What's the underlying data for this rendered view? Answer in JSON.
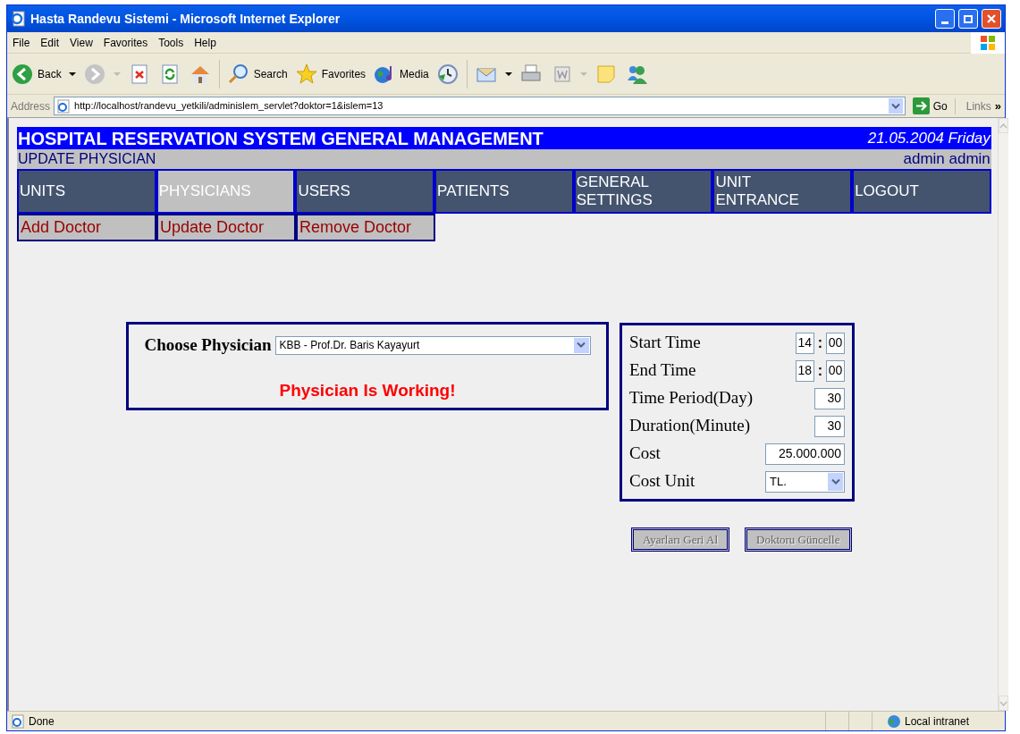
{
  "window": {
    "title": "Hasta Randevu Sistemi - Microsoft Internet Explorer"
  },
  "menu": [
    "File",
    "Edit",
    "View",
    "Favorites",
    "Tools",
    "Help"
  ],
  "toolbar": {
    "back": "Back",
    "search": "Search",
    "favorites": "Favorites",
    "media": "Media"
  },
  "address": {
    "label": "Address",
    "url": "http://localhost/randevu_yetkili/adminislem_servlet?doktor=1&islem=13",
    "go": "Go",
    "links": "Links",
    "more": "»"
  },
  "header": {
    "title": "HOSPITAL RESERVATION SYSTEM GENERAL MANAGEMENT",
    "date": "21.05.2004 Friday",
    "subtitle": "UPDATE PHYSICIAN",
    "user": "admin admin"
  },
  "nav": [
    {
      "label": "UNITS",
      "selected": false
    },
    {
      "label": "PHYSICIANS",
      "selected": true
    },
    {
      "label": "USERS",
      "selected": false
    },
    {
      "label": "PATIENTS",
      "selected": false
    },
    {
      "label": "GENERAL SETTINGS",
      "selected": false
    },
    {
      "label": "UNIT ENTRANCE",
      "selected": false
    },
    {
      "label": "LOGOUT",
      "selected": false
    }
  ],
  "subnav": [
    "Add Doctor",
    "Update Doctor",
    "Remove Doctor"
  ],
  "physician": {
    "label": "Choose Physician",
    "value": "KBB - Prof.Dr. Baris Kayayurt",
    "message": "Physician Is Working!"
  },
  "settings": [
    {
      "label": "Start Time",
      "kind": "time",
      "hour": "14",
      "sep": ":",
      "minute": "00"
    },
    {
      "label": "End Time",
      "kind": "time",
      "hour": "18",
      "sep": ":",
      "minute": "00"
    },
    {
      "label": "Time Period(Day)",
      "kind": "number",
      "value": "30"
    },
    {
      "label": "Duration(Minute)",
      "kind": "number",
      "value": "30"
    },
    {
      "label": "Cost",
      "kind": "text",
      "value": "25.000.000"
    },
    {
      "label": "Cost Unit",
      "kind": "select",
      "value": "TL."
    }
  ],
  "buttons": [
    {
      "label": "Ayarları Geri Al",
      "disabled": true
    },
    {
      "label": "Doktoru Güncelle",
      "disabled": true
    }
  ],
  "status": {
    "text": "Done",
    "zone": "Local intranet"
  }
}
